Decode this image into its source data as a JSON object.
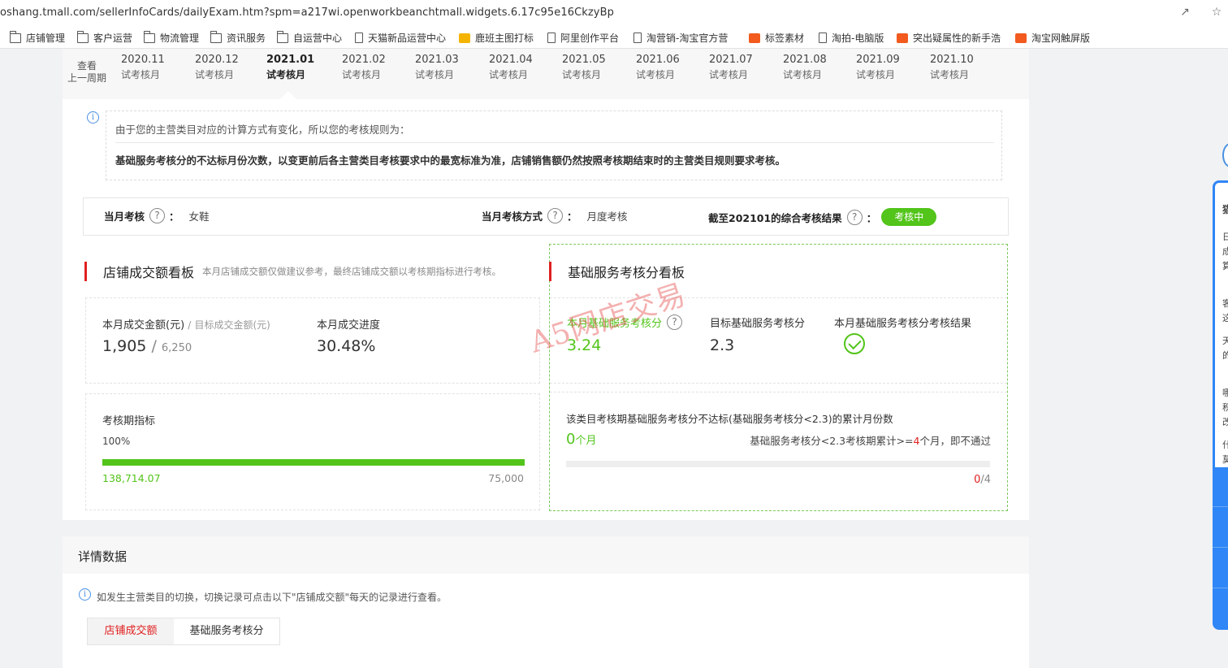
{
  "browser": {
    "url": "oshang.tmall.com/sellerInfoCards/dailyExam.htm?spm=a217wi.openworkbeanchtmall.widgets.6.17c95e16CkzyBp",
    "bookmarks": [
      {
        "label": "店铺管理",
        "icon": "folder-icon"
      },
      {
        "label": "客户运营",
        "icon": "folder-icon"
      },
      {
        "label": "物流管理",
        "icon": "folder-icon"
      },
      {
        "label": "资讯服务",
        "icon": "folder-icon"
      },
      {
        "label": "自运营中心",
        "icon": "folder-icon"
      },
      {
        "label": "天猫新品运营中心",
        "icon": "page-icon"
      },
      {
        "label": "鹿班主图打标",
        "icon": "app-icon"
      },
      {
        "label": "阿里创作平台",
        "icon": "page-icon"
      },
      {
        "label": "淘营销-淘宝官方营",
        "icon": "page-icon"
      },
      {
        "label": "标签素材",
        "icon": "app-icon"
      },
      {
        "label": "淘拍-电脑版",
        "icon": "page-icon"
      },
      {
        "label": "突出疑属性的新手浩",
        "icon": "app-icon"
      },
      {
        "label": "淘宝网触屏版",
        "icon": "app-icon"
      }
    ]
  },
  "months": {
    "prev_line1": "查看",
    "prev_line2": "上一周期",
    "items": [
      {
        "period": "2020.11",
        "status": "试考核月"
      },
      {
        "period": "2020.12",
        "status": "试考核月"
      },
      {
        "period": "2021.01",
        "status": "试考核月",
        "active": true
      },
      {
        "period": "2021.02",
        "status": "试考核月"
      },
      {
        "period": "2021.03",
        "status": "试考核月"
      },
      {
        "period": "2021.04",
        "status": "试考核月"
      },
      {
        "period": "2021.05",
        "status": "试考核月"
      },
      {
        "period": "2021.06",
        "status": "试考核月"
      },
      {
        "period": "2021.07",
        "status": "试考核月"
      },
      {
        "period": "2021.08",
        "status": "试考核月"
      },
      {
        "period": "2021.09",
        "status": "试考核月"
      },
      {
        "period": "2021.10",
        "status": "试考核月"
      }
    ]
  },
  "notice": {
    "info_glyph": "i",
    "line1": "由于您的主营类目对应的计算方式有变化，所以您的考核规则为：",
    "line2": "基础服务考核分的不达标月份次数，以变更前后各主营类目考核要求中的最宽标准为准，店铺销售额仍然按照考核期结束时的主营类目规则要求考核。"
  },
  "assessment": {
    "help_glyph": "?",
    "colon": "：",
    "monthly_label": "当月考核",
    "monthly_value": "女鞋",
    "method_label": "当月考核方式",
    "method_value": "月度考核",
    "result_label": "截至202101的综合考核结果",
    "result_badge": "考核中",
    "badge_color": "#52c41a"
  },
  "sales_board": {
    "title": "店铺成交额看板",
    "subtitle": "本月店铺成交额仅做建议参考，最终店铺成交额以考核期指标进行考核。",
    "amount_label": "本月成交金额(元)",
    "separator": "/",
    "target_label": "目标成交金额(元)",
    "amount_value": "1,905",
    "target_value": "6,250",
    "progress_label": "本月成交进度",
    "progress_value": "30.48%",
    "period_label": "考核期指标",
    "period_percent": "100%",
    "period_progress": 1.0,
    "period_actual": "138,714.07",
    "period_target": "75,000"
  },
  "service_board": {
    "title": "基础服务考核分看板",
    "help_glyph": "?",
    "score_label": "本月基础服务考核分",
    "score_value": "3.24",
    "target_label": "目标基础服务考核分",
    "target_value": "2.3",
    "result_label": "本月基础服务考核分考核结果",
    "fail_label": "该类目考核期基础服务考核分不达标(基础服务考核分<2.3)的累计月份数",
    "fail_count": "0",
    "fail_unit": "个月",
    "rule_prefix": "基础服务考核分<2.3考核期累计>=",
    "rule_count": "4",
    "rule_suffix": "个月，即不通过",
    "progress_current": "0",
    "progress_total": "/4",
    "progress_fraction": 0.0
  },
  "watermark": "A5网店交易",
  "details": {
    "title": "详情数据",
    "info_glyph": "i",
    "note": "如发生主营类目的切换，切换记录可点击以下\"店铺成交额\"每天的记录进行查看。",
    "tabs": [
      {
        "label": "店铺成交额",
        "active": true
      },
      {
        "label": "基础服务考核分",
        "active": false
      }
    ]
  },
  "side_panel": {
    "chars": [
      "猫",
      "日",
      "成",
      "算",
      "客",
      "这",
      "天",
      "的",
      "哪",
      "积",
      "改",
      "什",
      "莫"
    ]
  },
  "colors": {
    "accent_green": "#52c41a",
    "accent_red": "#e02020",
    "info_blue": "#4a90e2"
  }
}
